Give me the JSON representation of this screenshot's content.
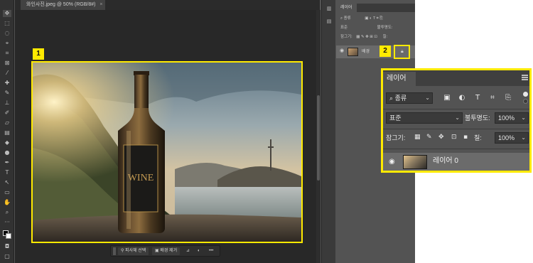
{
  "document": {
    "tab_title": "와인사진.jpeg @ 50% (RGB/8#)",
    "tab_close": "×"
  },
  "callouts": {
    "one": "1",
    "two": "2"
  },
  "context_bar": {
    "select_subject": "피사체 선택",
    "remove_background": "배경 제거",
    "more": "•••"
  },
  "photo": {
    "bottle_label": "WINE"
  },
  "small_panel": {
    "tab": "레이어",
    "kind_filter": "종류",
    "blend_mode": "표준",
    "opacity_label": "불투명도:",
    "lock_label": "잠그기:",
    "fill_label": "칠:",
    "layer_name": "배경"
  },
  "layers_panel": {
    "tab": "레이어",
    "kind_filter": "종류",
    "blend_mode": "표준",
    "opacity_label": "불투명도:",
    "opacity_value": "100%",
    "lock_label": "잠그기:",
    "fill_label": "칠:",
    "fill_value": "100%",
    "layer_name": "레이어 0"
  },
  "colors": {
    "highlight": "#ffea00",
    "panel_bg": "#535353",
    "toolbar_bg": "#323232"
  }
}
